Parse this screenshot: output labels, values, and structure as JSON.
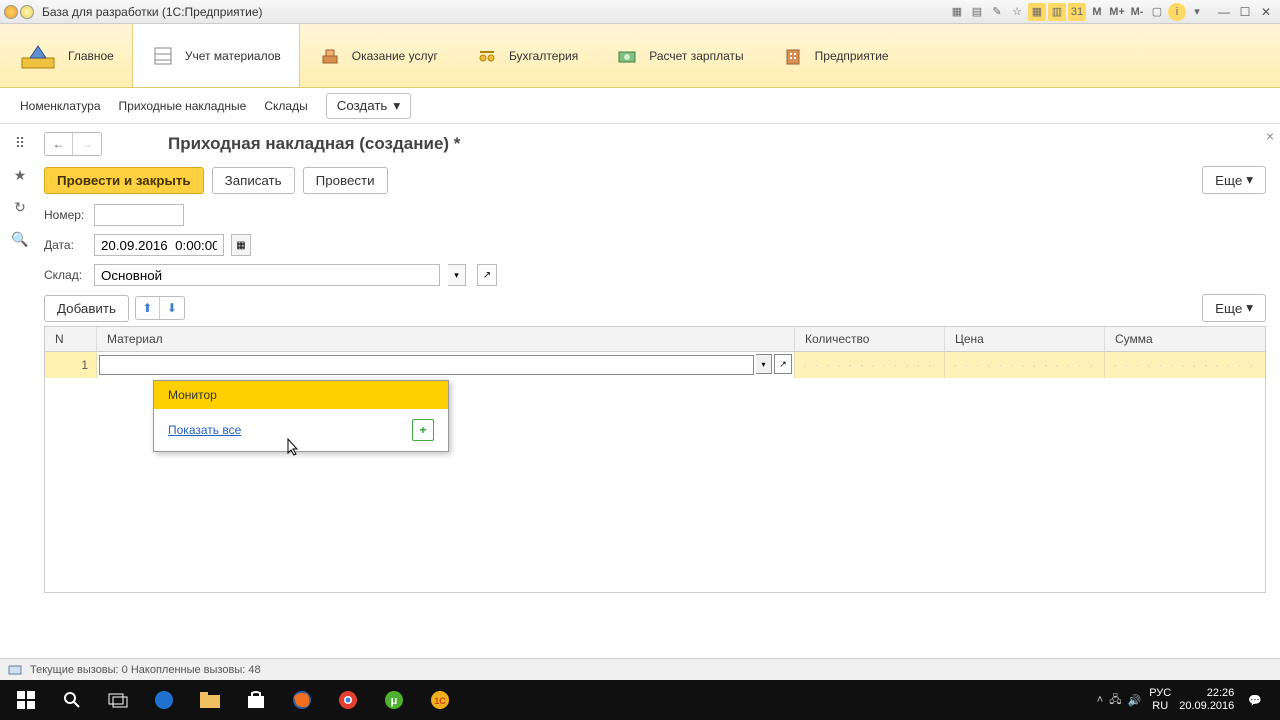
{
  "titlebar": {
    "title": "База для разработки  (1С:Предприятие)"
  },
  "tabs": {
    "main": "Главное",
    "materials": "Учет материалов",
    "services": "Оказание услуг",
    "accounting": "Бухгалтерия",
    "payroll": "Расчет зарплаты",
    "company": "Предприятие"
  },
  "subnav": {
    "nomenclature": "Номенклатура",
    "receipts": "Приходные накладные",
    "warehouses": "Склады",
    "create": "Создать"
  },
  "page": {
    "title": "Приходная накладная (создание) *",
    "post_close": "Провести и закрыть",
    "save": "Записать",
    "post": "Провести",
    "more": "Еще",
    "number_label": "Номер:",
    "date_label": "Дата:",
    "date_value": "20.09.2016  0:00:00",
    "sklad_label": "Склад:",
    "sklad_value": "Основной",
    "add": "Добавить"
  },
  "grid": {
    "col_n": "N",
    "col_material": "Материал",
    "col_qty": "Количество",
    "col_price": "Цена",
    "col_sum": "Сумма",
    "row_n": "1"
  },
  "dropdown": {
    "item": "Монитор",
    "show_all": "Показать все"
  },
  "status": {
    "text": "Текущие вызовы: 0  Накопленные вызовы: 48"
  },
  "taskbar": {
    "lang1": "РУС",
    "lang2": "RU",
    "time": "22:26",
    "date": "20.09.2016"
  }
}
